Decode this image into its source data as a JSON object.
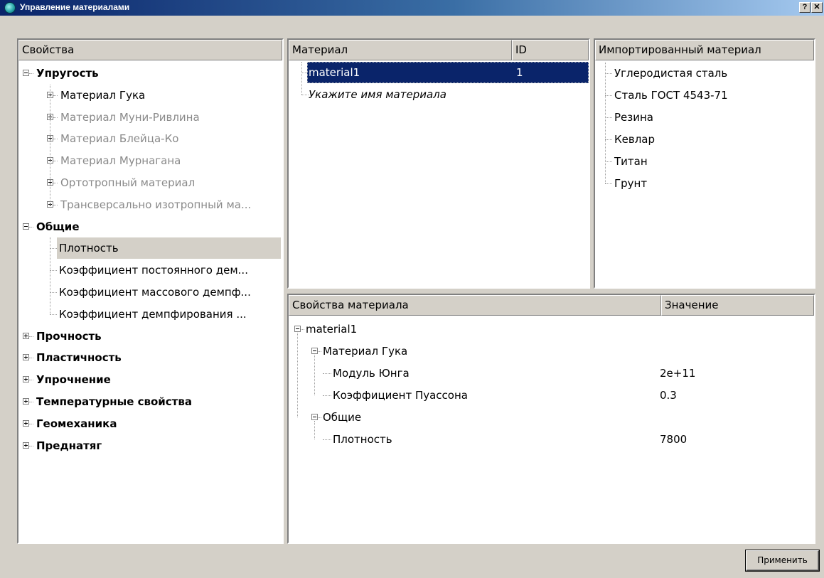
{
  "window": {
    "title": "Управление материалами",
    "help_label": "?",
    "close_label": "✕",
    "icon": "app-logo-icon"
  },
  "properties": {
    "header": "Свойства",
    "items": [
      {
        "label": "Упругость",
        "level": 0,
        "bold": true,
        "expander": "minus"
      },
      {
        "label": "Материал Гука",
        "level": 1,
        "expander": "plus"
      },
      {
        "label": "Материал Муни-Ривлина",
        "level": 1,
        "expander": "plus",
        "disabled": true
      },
      {
        "label": "Материал Блейца-Ко",
        "level": 1,
        "expander": "plus",
        "disabled": true
      },
      {
        "label": "Материал Мурнагана",
        "level": 1,
        "expander": "plus",
        "disabled": true
      },
      {
        "label": "Ортотропный материал",
        "level": 1,
        "expander": "plus",
        "disabled": true
      },
      {
        "label": "Трансверсально изотропный ма...",
        "level": 1,
        "expander": "plus",
        "disabled": true
      },
      {
        "label": "Общие",
        "level": 0,
        "bold": true,
        "expander": "minus"
      },
      {
        "label": "Плотность",
        "level": 1,
        "highlighted": true
      },
      {
        "label": "Коэффициент постоянного дем...",
        "level": 1
      },
      {
        "label": "Коэффициент массового демпф...",
        "level": 1
      },
      {
        "label": "Коэффициент демпфирования ...",
        "level": 1
      },
      {
        "label": "Прочность",
        "level": 0,
        "bold": true,
        "expander": "plus"
      },
      {
        "label": "Пластичность",
        "level": 0,
        "bold": true,
        "expander": "plus"
      },
      {
        "label": "Упрочнение",
        "level": 0,
        "bold": true,
        "expander": "plus"
      },
      {
        "label": "Температурные свойства",
        "level": 0,
        "bold": true,
        "expander": "plus"
      },
      {
        "label": "Геомеханика",
        "level": 0,
        "bold": true,
        "expander": "plus"
      },
      {
        "label": "Преднатяг",
        "level": 0,
        "bold": true,
        "expander": "plus"
      }
    ]
  },
  "materials": {
    "col_name": "Материал",
    "col_id": "ID",
    "rows": [
      {
        "name": "material1",
        "id": "1",
        "selected": true
      },
      {
        "name": "Укажите имя материала",
        "id": "",
        "placeholder": true
      }
    ]
  },
  "imported": {
    "header": "Импортированный материал",
    "items": [
      "Углеродистая сталь",
      "Сталь ГОСТ 4543-71",
      "Резина",
      "Кевлар",
      "Титан",
      "Грунт"
    ]
  },
  "material_properties": {
    "col_name": "Свойства материала",
    "col_value": "Значение",
    "rows": [
      {
        "label": "material1",
        "value": "",
        "level": 0,
        "expander": "minus"
      },
      {
        "label": "Материал Гука",
        "value": "",
        "level": 1,
        "expander": "minus"
      },
      {
        "label": "Модуль Юнга",
        "value": "2e+11",
        "level": 2
      },
      {
        "label": "Коэффициент Пуассона",
        "value": "0.3",
        "level": 2
      },
      {
        "label": "Общие",
        "value": "",
        "level": 1,
        "expander": "minus"
      },
      {
        "label": "Плотность",
        "value": "7800",
        "level": 2
      }
    ]
  },
  "apply_label": "Применить"
}
